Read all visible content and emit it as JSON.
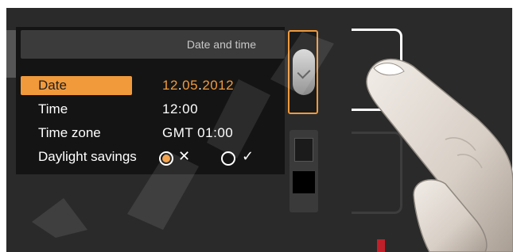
{
  "screen": {
    "title": "Date and time",
    "rows": [
      {
        "label": "Date",
        "selected": true,
        "value": {
          "day": "12",
          "month": "05",
          "year": "2012",
          "sep": "."
        }
      },
      {
        "label": "Time",
        "value": "12:00"
      },
      {
        "label": "Time zone",
        "value": "GMT 01:00"
      },
      {
        "label": "Daylight savings",
        "options": [
          {
            "symbol": "✕",
            "selected": true
          },
          {
            "symbol": "✓",
            "selected": false
          }
        ]
      }
    ]
  },
  "colors": {
    "accent": "#f19a3b",
    "panel": "#2a2a2a",
    "screen": "#141414",
    "title_bar": "#3b3b3b"
  },
  "icons": {
    "active_thumbnail": "clock-icon"
  }
}
